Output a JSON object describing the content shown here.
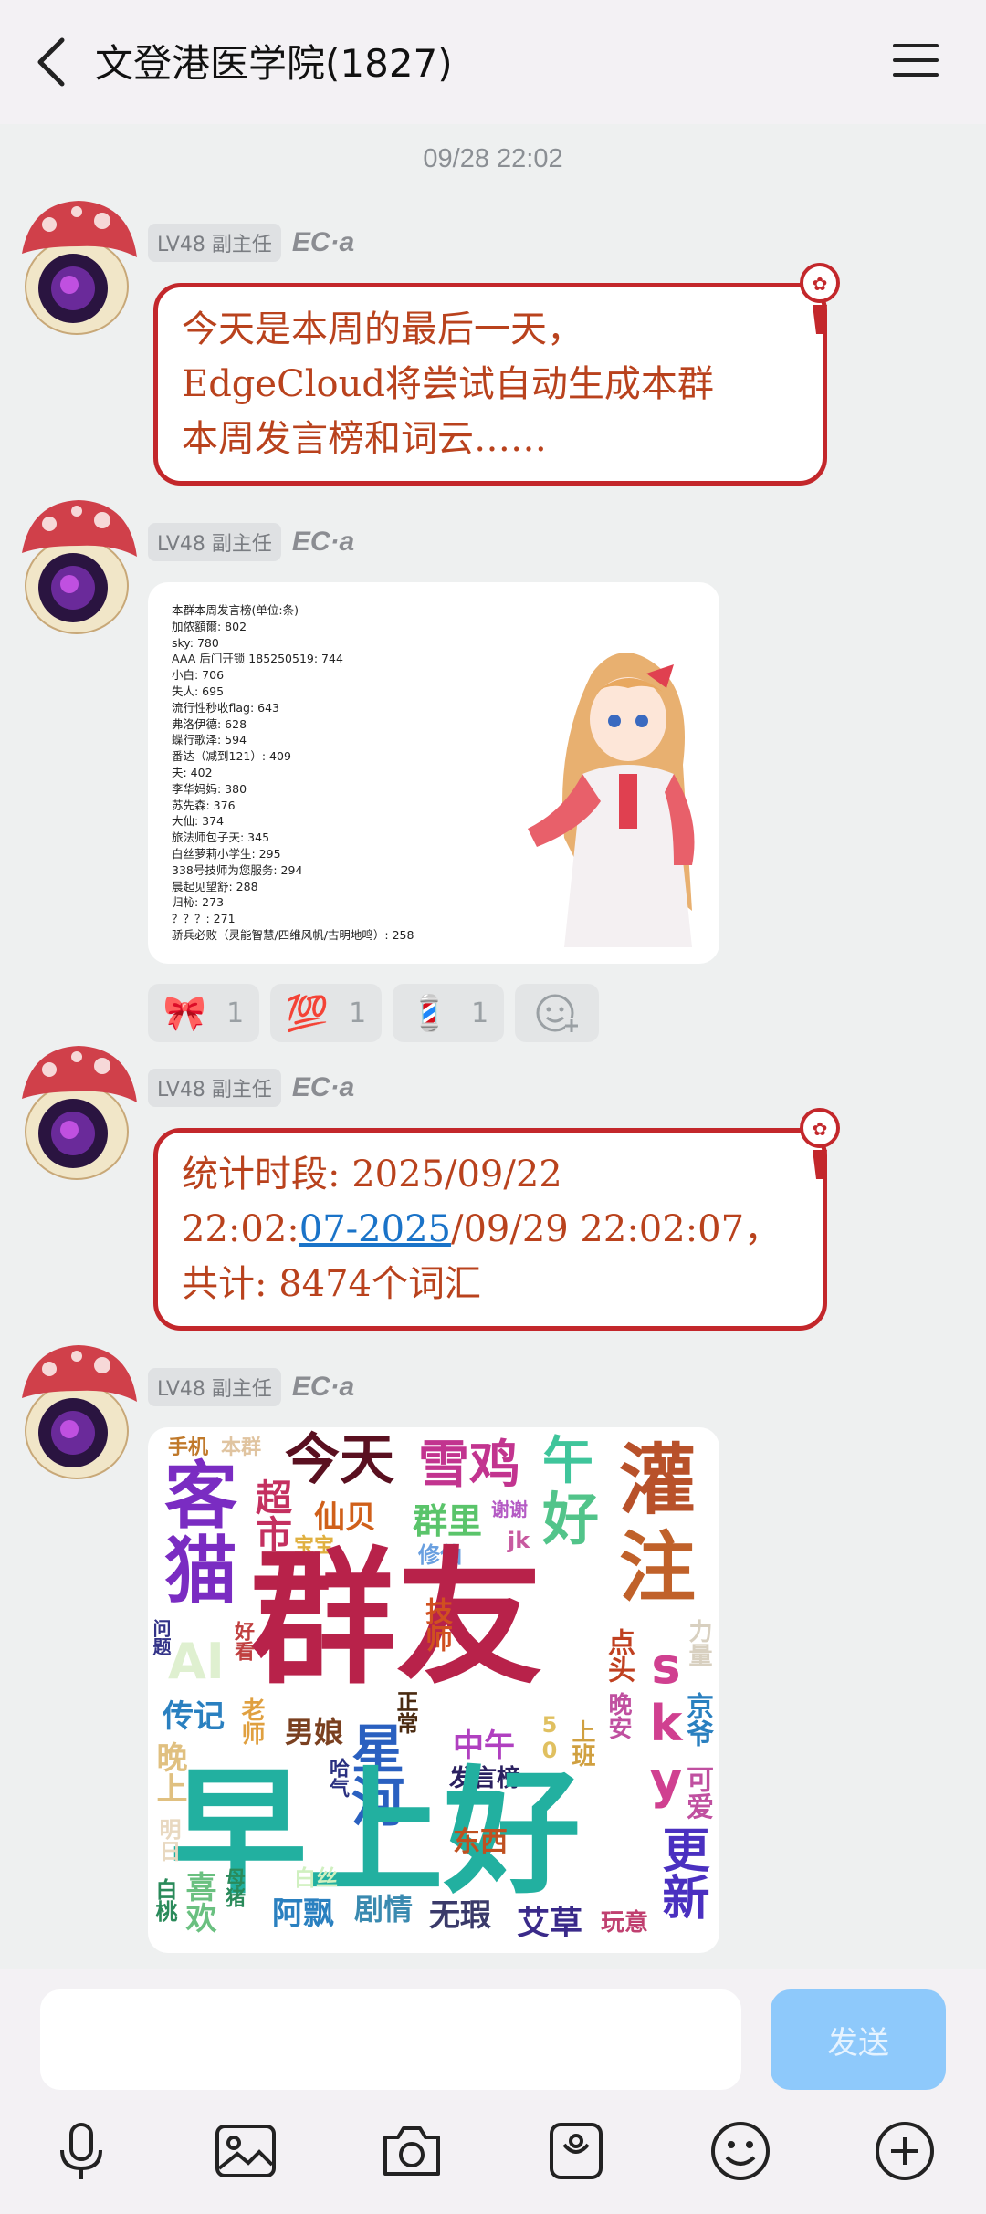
{
  "header": {
    "title": "文登港医学院(1827)",
    "back_icon": "chevron-left-icon",
    "menu_icon": "hamburger-menu-icon"
  },
  "chat": {
    "timestamp": "09/28 22:02",
    "sender_level": "LV48 副主任",
    "sender_name": "EC·a",
    "msg1_line1": "今天是本周的最后一天，",
    "msg1_line2": "EdgeCloud将尝试自动生成本群",
    "msg1_line3": "本周发言榜和词云……",
    "rank_list": [
      "本群本周发言榜(单位:条)",
      "加侬額爾: 802",
      "sky: 780",
      "AAA 后门开锁 185250519: 744",
      "小白: 706",
      "失人: 695",
      "流行性秒收flag: 643",
      "弗洛伊德: 628",
      "蝶行歌泽: 594",
      "番达（减到121）: 409",
      "夫: 402",
      "李华妈妈: 380",
      "苏先森: 376",
      "大仙: 374",
      "旅法师包子天: 345",
      "白丝萝莉小学生: 295",
      "338号技师为您服务: 294",
      "晨起见望舒: 288",
      "归杺: 273",
      "？？？: 271",
      "骄兵必败（灵能智慧/四维风帆/古明地鸣）: 258"
    ],
    "reactions": [
      {
        "emoji": "🎀",
        "count": "1",
        "icon": "ribbon-icon"
      },
      {
        "emoji": "💯",
        "count": "1",
        "icon": "hundred-points-icon"
      },
      {
        "emoji": "💈",
        "count": "1",
        "icon": "barber-pole-icon"
      }
    ],
    "msg3_part1": "统计时段: 2025/09/22",
    "msg3_part2": "22:02:",
    "msg3_link": "07-2025",
    "msg3_part3": "/09/29 22:02:07，",
    "msg3_part4": "共计: 8474个词汇",
    "wordcloud": [
      {
        "w": "手机",
        "c": "#c0792a"
      },
      {
        "w": "本群",
        "c": "#e0c4a0"
      },
      {
        "w": "今天",
        "c": "#5a1020"
      },
      {
        "w": "雪鸡",
        "c": "#c2348f"
      },
      {
        "w": "午",
        "c": "#3fc59b"
      },
      {
        "w": "好",
        "c": "#52c48a"
      },
      {
        "w": "灌",
        "c": "#b8512a"
      },
      {
        "w": "注",
        "c": "#c0612a"
      },
      {
        "w": "客",
        "c": "#7a2cc2"
      },
      {
        "w": "超",
        "c": "#c43060"
      },
      {
        "w": "市",
        "c": "#c43060"
      },
      {
        "w": "仙贝",
        "c": "#d0601a"
      },
      {
        "w": "群里",
        "c": "#5ac46a"
      },
      {
        "w": "谢谢",
        "c": "#b45ac4"
      },
      {
        "w": "猫",
        "c": "#7a2cc2"
      },
      {
        "w": "宝宝",
        "c": "#e0b040"
      },
      {
        "w": "修仙",
        "c": "#6aa0e0"
      },
      {
        "w": "jk",
        "c": "#c85aa0"
      },
      {
        "w": "群友",
        "c": "#b8224a"
      },
      {
        "w": "问题",
        "c": "#333388"
      },
      {
        "w": "AI",
        "c": "#dff0d0"
      },
      {
        "w": "好看",
        "c": "#c04040"
      },
      {
        "w": "技师",
        "c": "#d05020"
      },
      {
        "w": "点头",
        "c": "#c04020"
      },
      {
        "w": "sky",
        "c": "#d04090"
      },
      {
        "w": "力量",
        "c": "#d8d0c0"
      },
      {
        "w": "京爷",
        "c": "#2a80c0"
      },
      {
        "w": "传记",
        "c": "#2a80c0"
      },
      {
        "w": "老师",
        "c": "#e0a040"
      },
      {
        "w": "男娘",
        "c": "#7a4020"
      },
      {
        "w": "正常",
        "c": "#4a2a10"
      },
      {
        "w": "中午",
        "c": "#b040c0"
      },
      {
        "w": "50",
        "c": "#e0c060"
      },
      {
        "w": "上班",
        "c": "#d0a040"
      },
      {
        "w": "晚安",
        "c": "#c050a0"
      },
      {
        "w": "可爱",
        "c": "#c050a0"
      },
      {
        "w": "晚上",
        "c": "#e0c080"
      },
      {
        "w": "哈气",
        "c": "#2a3080"
      },
      {
        "w": "星",
        "c": "#2a60c0"
      },
      {
        "w": "河",
        "c": "#2a60c0"
      },
      {
        "w": "发言榜",
        "c": "#2a2060"
      },
      {
        "w": "早上好",
        "c": "#22b0a0"
      },
      {
        "w": "更",
        "c": "#4a30c0"
      },
      {
        "w": "新",
        "c": "#4a30c0"
      },
      {
        "w": "明日",
        "c": "#e8d8c0"
      },
      {
        "w": "东西",
        "c": "#c05020"
      },
      {
        "w": "白丝",
        "c": "#d0f0c0"
      },
      {
        "w": "白桃",
        "c": "#2a8a5a"
      },
      {
        "w": "喜欢",
        "c": "#6ac080"
      },
      {
        "w": "母猪",
        "c": "#2a8a5a"
      },
      {
        "w": "阿飘",
        "c": "#2a80c0"
      },
      {
        "w": "剧情",
        "c": "#3a8ab0"
      },
      {
        "w": "无瑕",
        "c": "#3a3a6a"
      },
      {
        "w": "艾草",
        "c": "#3a2a8a"
      },
      {
        "w": "玩意",
        "c": "#c04070"
      }
    ]
  },
  "input": {
    "placeholder": "",
    "send_label": "发送"
  },
  "toolbar": {
    "icons": [
      "microphone-icon",
      "image-icon",
      "camera-icon",
      "sticker-icon",
      "emoji-icon",
      "plus-icon"
    ]
  },
  "colors": {
    "bubble_border": "#c3272b",
    "bubble_text": "#b9421d",
    "send_button": "#8ec9fb"
  }
}
